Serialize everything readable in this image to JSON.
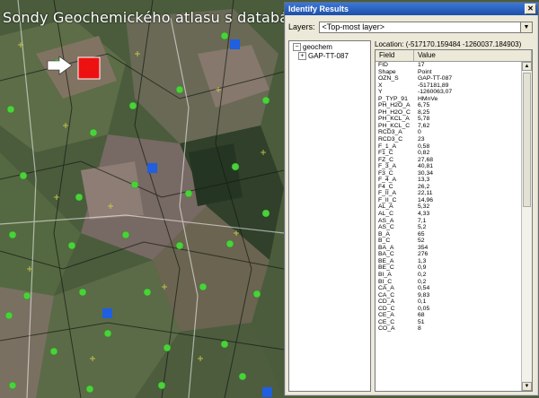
{
  "map": {
    "title": "Sondy Geochemického atlasu s databázou"
  },
  "identify": {
    "title": "Identify Results",
    "layers_label": "Layers:",
    "layers_value": "<Top-most layer>",
    "tree_root": "geochem",
    "tree_child": "GAP-TT-087",
    "location": "Location: (-517170.159484 -1260037.184903)",
    "columns": [
      "Field",
      "Value"
    ],
    "rows": [
      [
        "FID",
        "17"
      ],
      [
        "Shape",
        "Point"
      ],
      [
        "OZN_S",
        "GAP-TT-087"
      ],
      [
        "X",
        "-517181,89"
      ],
      [
        "Y",
        "-1260063,07"
      ],
      [
        "P_TYP_91",
        "HMnVe"
      ],
      [
        "PH_H2O_A",
        "6,75"
      ],
      [
        "PH_H2O_C",
        "8,25"
      ],
      [
        "PH_KCL_A",
        "5,78"
      ],
      [
        "PH_KCL_C",
        "7,62"
      ],
      [
        "RCD3_A",
        "0"
      ],
      [
        "RCD3_C",
        "23"
      ],
      [
        "F_1_A",
        "0,58"
      ],
      [
        "F1_C",
        "0,82"
      ],
      [
        "FZ_C",
        "27,68"
      ],
      [
        "F_3_A",
        "40,81"
      ],
      [
        "F3_C",
        "30,34"
      ],
      [
        "F_4_A",
        "13,3"
      ],
      [
        "F4_C",
        "26,2"
      ],
      [
        "F_II_A",
        "22,11"
      ],
      [
        "F_II_C",
        "14,96"
      ],
      [
        "AL_A",
        "5,32"
      ],
      [
        "AL_C",
        "4,33"
      ],
      [
        "AS_A",
        "7,1"
      ],
      [
        "AS_C",
        "5,2"
      ],
      [
        "B_A",
        "65"
      ],
      [
        "B_C",
        "52"
      ],
      [
        "BA_A",
        "354"
      ],
      [
        "BA_C",
        "276"
      ],
      [
        "BE_A",
        "1,3"
      ],
      [
        "BE_C",
        "0,9"
      ],
      [
        "BI_A",
        "0,2"
      ],
      [
        "BI_C",
        "0,2"
      ],
      [
        "CA_A",
        "0,54"
      ],
      [
        "CA_C",
        "9,83"
      ],
      [
        "CD_A",
        "0,1"
      ],
      [
        "CD_C",
        "0,05"
      ],
      [
        "CE_A",
        "68"
      ],
      [
        "CE_C",
        "51"
      ],
      [
        "CO_A",
        "8"
      ]
    ]
  }
}
